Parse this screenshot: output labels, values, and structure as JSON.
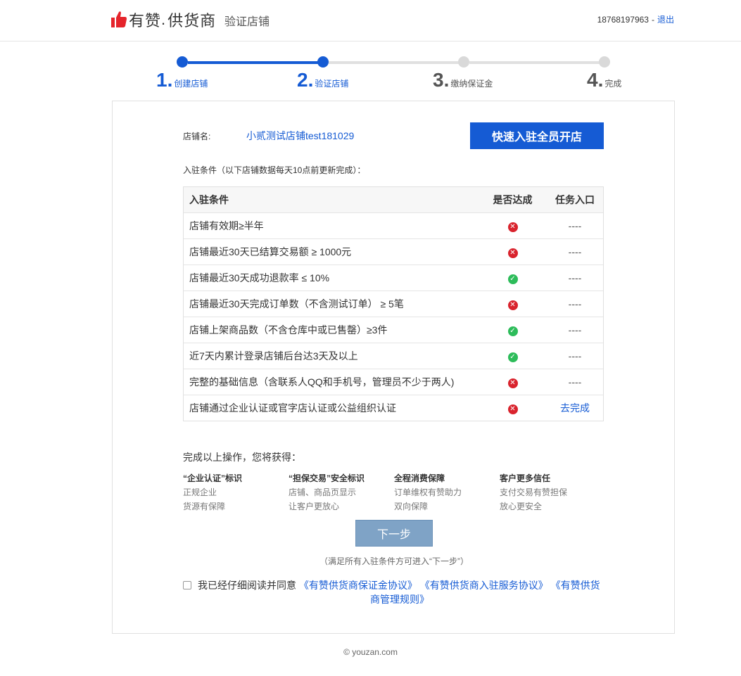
{
  "header": {
    "brand": "有赞",
    "brand_sub": "供货商",
    "page_title": "验证店铺",
    "phone": "18768197963",
    "separator": "-",
    "logout": "退出",
    "brand_color": "#e5242b"
  },
  "steps": [
    {
      "num": "1.",
      "label": "创建店铺",
      "state": "done"
    },
    {
      "num": "2.",
      "label": "验证店铺",
      "state": "active"
    },
    {
      "num": "3.",
      "label": "缴纳保证金",
      "state": "todo"
    },
    {
      "num": "4.",
      "label": "完成",
      "state": "todo"
    }
  ],
  "shop": {
    "label": "店铺名:",
    "name": "小贰测试店铺test181029",
    "fast_button": "快速入驻全员开店"
  },
  "conditions_note": "入驻条件（以下店铺数据每天10点前更新完成）：",
  "table": {
    "headers": [
      "入驻条件",
      "是否达成",
      "任务入口"
    ],
    "rows": [
      {
        "cond": "店铺有效期≥半年",
        "met": false,
        "entry": "----"
      },
      {
        "cond": "店铺最近30天已结算交易额 ≥ 1000元",
        "met": false,
        "entry": "----"
      },
      {
        "cond": "店铺最近30天成功退款率 ≤ 10%",
        "met": true,
        "entry": "----"
      },
      {
        "cond": "店铺最近30天完成订单数（不含测试订单） ≥ 5笔",
        "met": false,
        "entry": "----"
      },
      {
        "cond": "店铺上架商品数（不含仓库中或已售罄）≥3件",
        "met": true,
        "entry": "----"
      },
      {
        "cond": "近7天内累计登录店铺后台达3天及以上",
        "met": true,
        "entry": "----"
      },
      {
        "cond": "完整的基础信息（含联系人QQ和手机号，管理员不少于两人)",
        "met": false,
        "entry": "----"
      },
      {
        "cond": "店铺通过企业认证或官字店认证或公益组织认证",
        "met": false,
        "entry": "去完成"
      }
    ]
  },
  "benefits_title": "完成以上操作，您将获得：",
  "benefits": [
    {
      "title": "“企业认证”标识",
      "lines": [
        "正规企业",
        "货源有保障"
      ]
    },
    {
      "title": "“担保交易”安全标识",
      "lines": [
        "店铺、商品页显示",
        "让客户更放心"
      ]
    },
    {
      "title": "全程消费保障",
      "lines": [
        "订单维权有赞助力",
        "双向保障"
      ]
    },
    {
      "title": "客户更多信任",
      "lines": [
        "支付交易有赞担保",
        "放心更安全"
      ]
    }
  ],
  "next_button": "下一步",
  "next_note": "（满足所有入驻条件方可进入“下一步”）",
  "agreement": {
    "prefix": "我已经仔细阅读并同意",
    "link1": "《有赞供货商保证金协议》",
    "link2": "《有赞供货商入驻服务协议》",
    "link3a": "《有赞供货",
    "link3b": "商管理规则》",
    "checked": false
  },
  "footer": "© youzan.com",
  "colors": {
    "accent": "#155bd4",
    "ok": "#2dbc5a",
    "fail": "#d9232d",
    "disabled_btn": "#7fa3c6"
  }
}
